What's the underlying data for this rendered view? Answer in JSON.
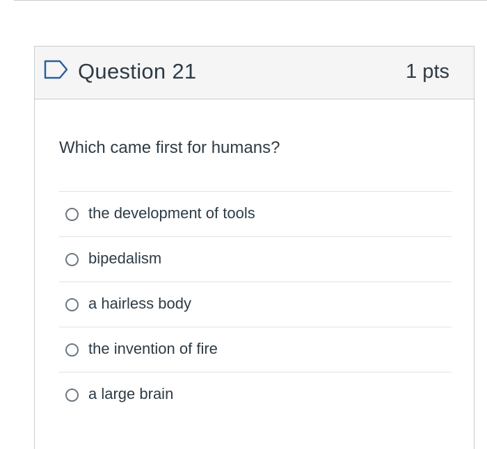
{
  "question": {
    "title": "Question 21",
    "points": "1 pts",
    "flag_icon": "flag-outline-icon",
    "text": "Which came first for humans?",
    "answers": [
      {
        "label": "the development of tools",
        "selected": false
      },
      {
        "label": "bipedalism",
        "selected": false
      },
      {
        "label": "a hairless body",
        "selected": false
      },
      {
        "label": "the invention of fire",
        "selected": false
      },
      {
        "label": "a large brain",
        "selected": false
      }
    ]
  },
  "colors": {
    "accent": "#2d3b45",
    "header_bg": "#f5f5f5",
    "border": "#c7cdd1",
    "divider": "#dfe3e6",
    "radio_border": "#6b7780"
  }
}
